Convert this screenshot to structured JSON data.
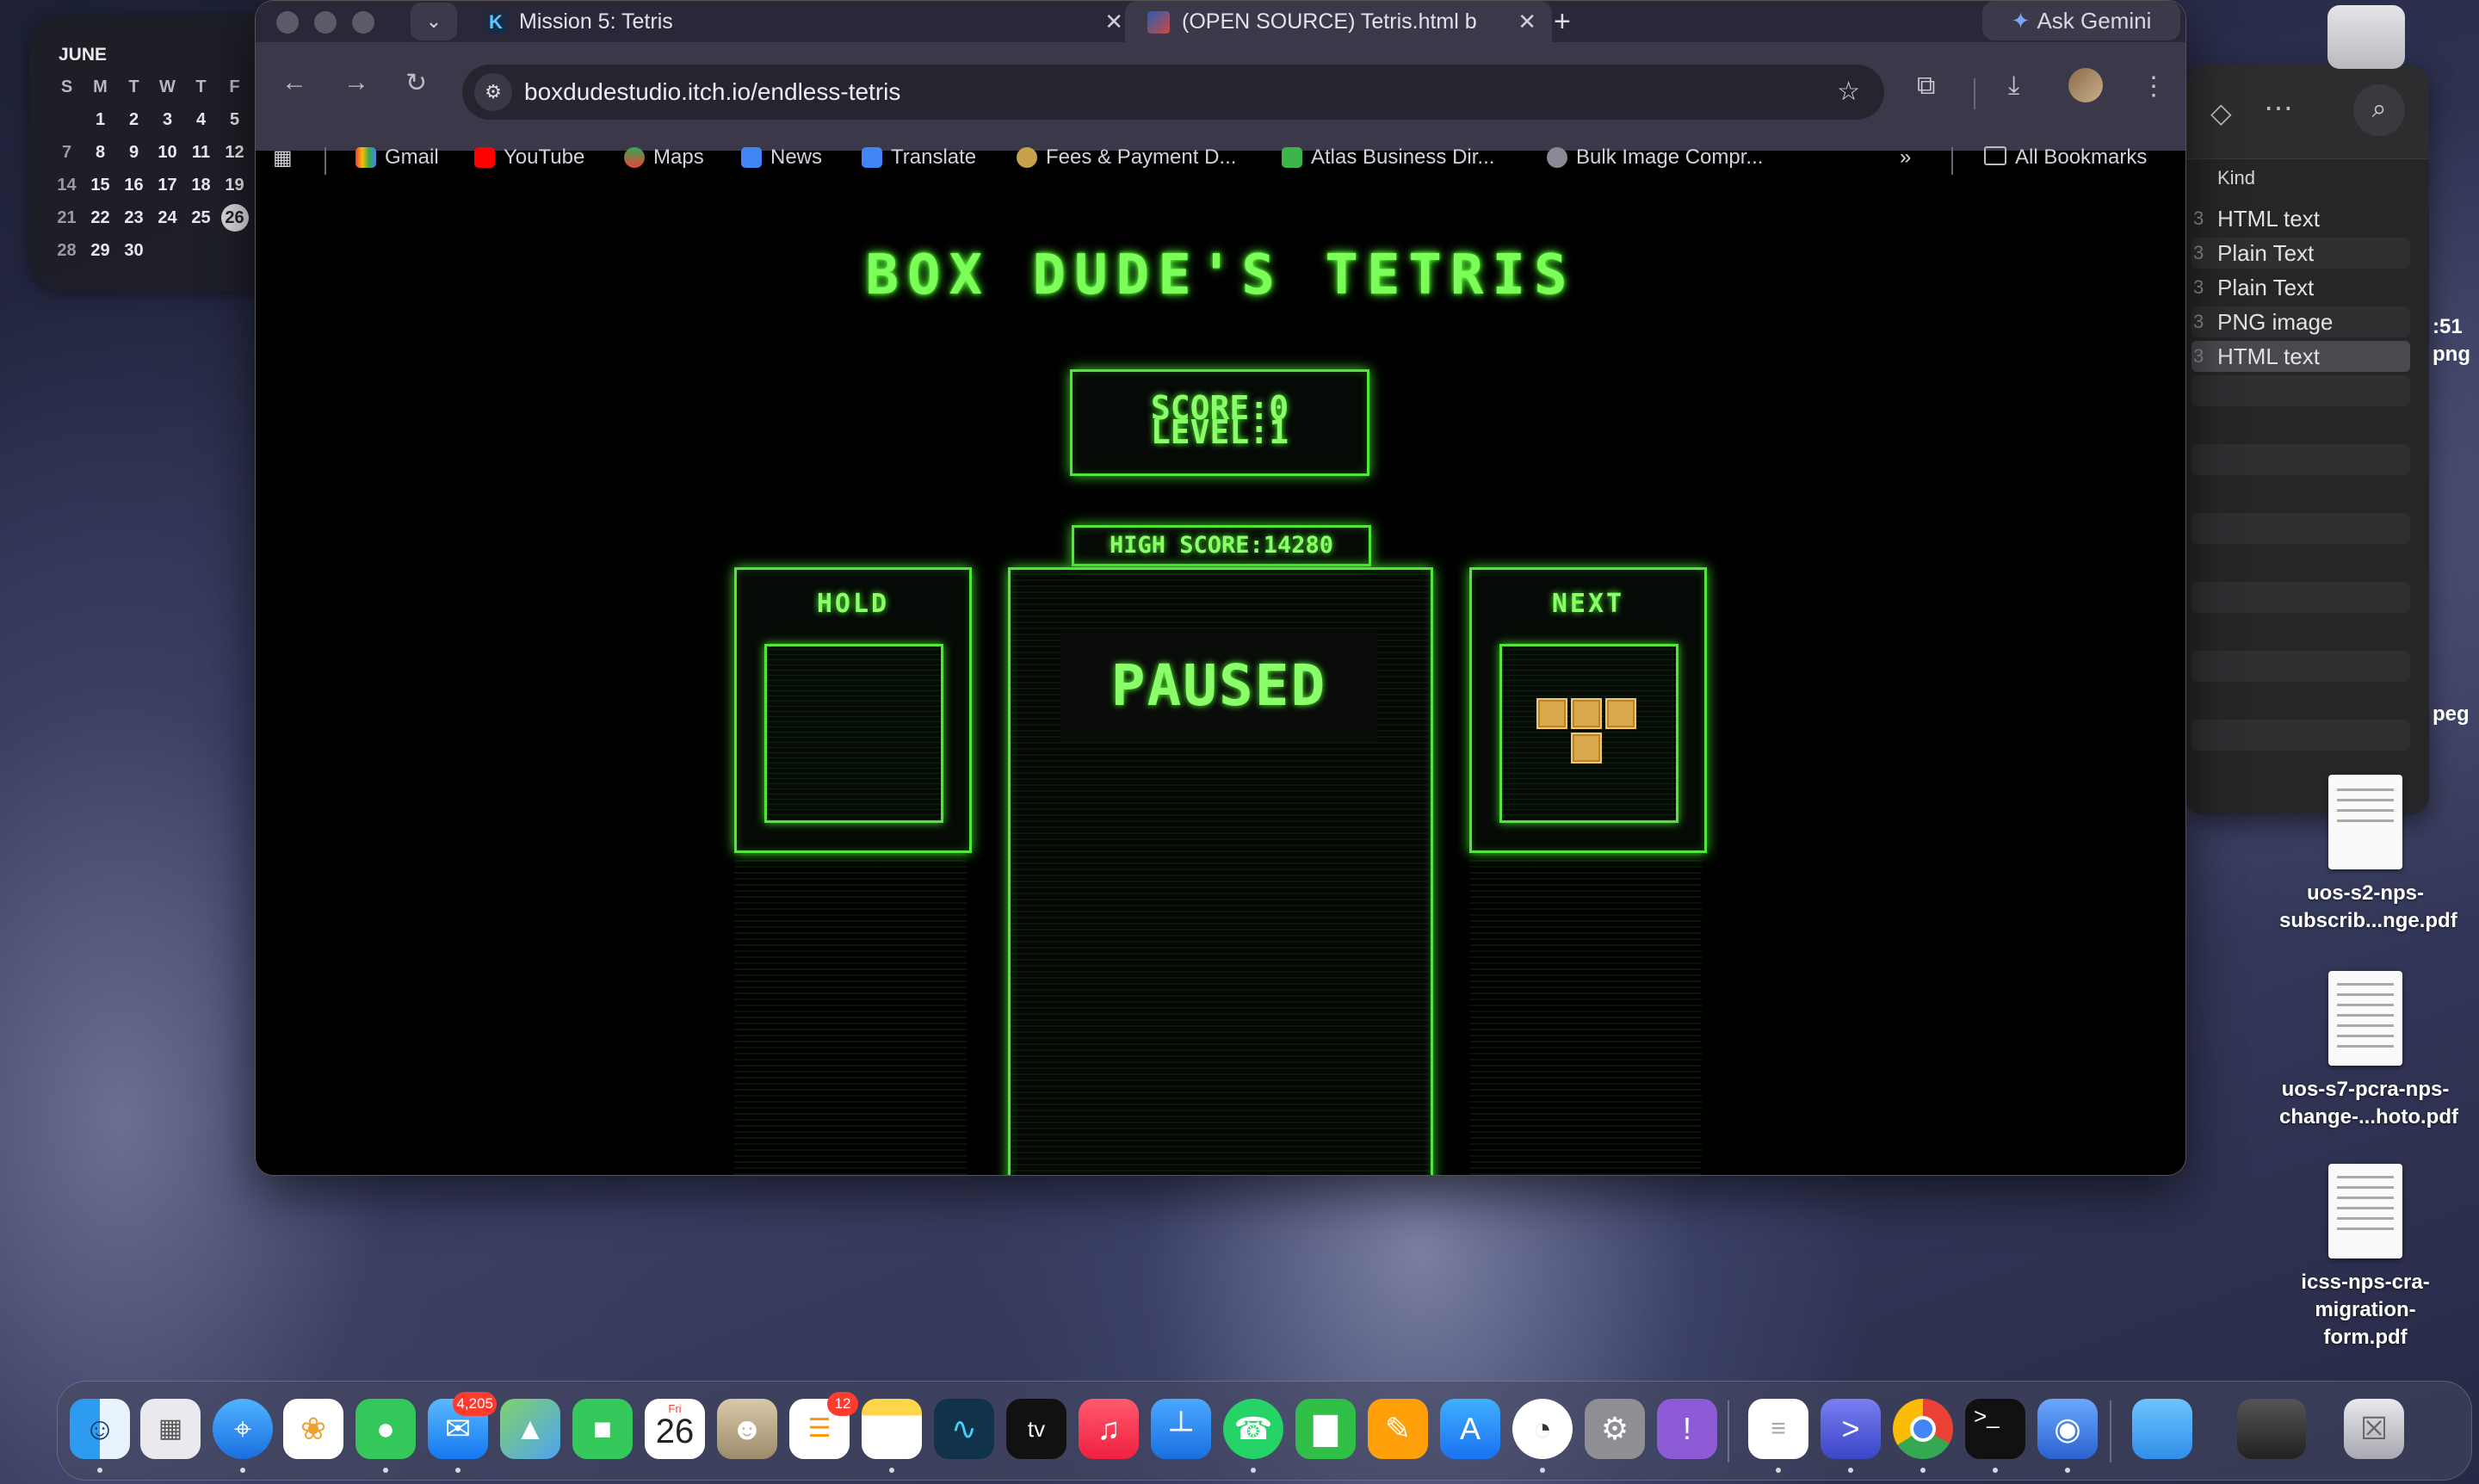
{
  "calendar": {
    "month": "JUNE",
    "headers": [
      "S",
      "M",
      "T",
      "W",
      "T",
      "F"
    ],
    "rows": [
      [
        "",
        "1",
        "2",
        "3",
        "4",
        "5"
      ],
      [
        "7",
        "8",
        "9",
        "10",
        "11",
        "12"
      ],
      [
        "14",
        "15",
        "16",
        "17",
        "18",
        "19"
      ],
      [
        "21",
        "22",
        "23",
        "24",
        "25",
        "26"
      ],
      [
        "28",
        "29",
        "30",
        "",
        "",
        ""
      ]
    ],
    "today": "26"
  },
  "browser": {
    "tabs": [
      {
        "title": "Mission 5: Tetris",
        "favicon": "K"
      },
      {
        "title": "(OPEN SOURCE) Tetris.html b"
      }
    ],
    "ask_gemini": "Ask Gemini",
    "url": "boxdudestudio.itch.io/endless-tetris",
    "bookmarks": [
      "Gmail",
      "YouTube",
      "Maps",
      "News",
      "Translate",
      "Fees & Payment D...",
      "Atlas Business Dir...",
      "Bulk Image Compr..."
    ],
    "all_bookmarks": "All Bookmarks"
  },
  "game": {
    "title": "BOX DUDE'S TETRIS",
    "score_label": "SCORE:0",
    "level_label": "LEVEL:1",
    "high_score_label": "HIGH SCORE:14280",
    "hold_label": "HOLD",
    "next_label": "NEXT",
    "paused_label": "PAUSED",
    "next_piece": "T",
    "piece_color": "#d9a94b",
    "accent_color": "#53e63a"
  },
  "finder": {
    "kind_header": "Kind",
    "rows": [
      {
        "kind": "HTML text"
      },
      {
        "kind": "Plain Text"
      },
      {
        "kind": "Plain Text"
      },
      {
        "kind": "PNG image"
      },
      {
        "kind": "HTML text"
      }
    ],
    "row_prefix": "3",
    "peek_time": ":51",
    "peek_ext1": "png",
    "peek_ext2": "peg"
  },
  "desktop_files": [
    {
      "line1": "uos-s2-nps-",
      "line2": "subscrib...nge.pdf"
    },
    {
      "line1": "uos-s7-pcra-nps-",
      "line2": "change-...hoto.pdf"
    },
    {
      "line1": "icss-nps-cra-",
      "line2": "migration-form.pdf"
    }
  ],
  "dock": {
    "mail_badge": "4,205",
    "reminders_badge": "12",
    "calendar_day": "Fri",
    "calendar_date": "26",
    "apps": [
      "finder",
      "launchpad",
      "safari",
      "photos",
      "messages",
      "mail",
      "maps",
      "facetime",
      "calendar",
      "contacts",
      "reminders",
      "notes",
      "freeform",
      "tv",
      "music",
      "keynote",
      "whatsapp",
      "numbers",
      "pages",
      "app-store",
      "onedrive",
      "system-settings",
      "feedback",
      "textedit",
      "remote",
      "chrome",
      "terminal",
      "disk-utility",
      "downloads-folder",
      "screenshot-stack",
      "trash"
    ]
  }
}
